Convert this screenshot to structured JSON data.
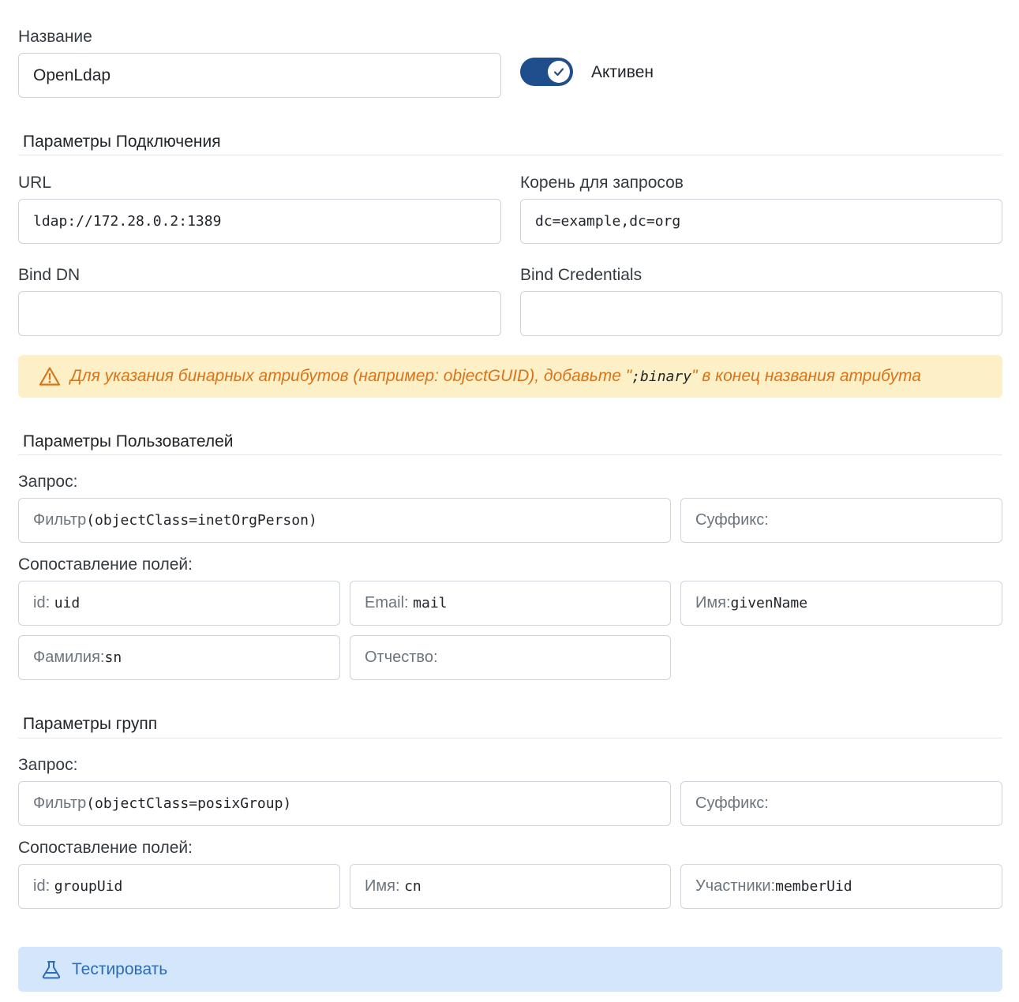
{
  "name": {
    "label": "Название",
    "value": "OpenLdap"
  },
  "active": {
    "label": "Активен",
    "checked": true
  },
  "connection": {
    "title": "Параметры Подключения",
    "url_label": "URL",
    "url_value": "ldap://172.28.0.2:1389",
    "root_label": "Корень для запросов",
    "root_value": "dc=example,dc=org",
    "bind_dn_label": "Bind DN",
    "bind_dn_value": "",
    "bind_cred_label": "Bind Credentials",
    "bind_cred_value": ""
  },
  "alert": {
    "text_before": "Для указания бинарных атрибутов (например: objectGUID), добавьте \"",
    "code": ";binary",
    "text_after": "\" в конец названия атрибута"
  },
  "users": {
    "title": "Параметры Пользователей",
    "query_label": "Запрос:",
    "filter_prefix": "Фильтр",
    "filter_value": "(objectClass=inetOrgPerson)",
    "suffix_placeholder": "Суффикс:",
    "mapping_label": "Сопоставление полей:",
    "id_prefix": "id: ",
    "id_value": "uid",
    "email_prefix": "Email: ",
    "email_value": "mail",
    "firstname_prefix": "Имя: ",
    "firstname_value": "givenName",
    "lastname_prefix": "Фамилия:",
    "lastname_value": "sn",
    "middlename_placeholder": "Отчество:"
  },
  "groups": {
    "title": "Параметры групп",
    "query_label": "Запрос:",
    "filter_prefix": "Фильтр",
    "filter_value": "(objectClass=posixGroup)",
    "suffix_placeholder": "Суффикс:",
    "mapping_label": "Сопоставление полей:",
    "id_prefix": "id: ",
    "id_value": "groupUid",
    "name_prefix": "Имя: ",
    "name_value": "cn",
    "members_prefix": "Участники:",
    "members_value": "memberUid"
  },
  "test_button": {
    "label": "Тестировать",
    "icon": "flask-icon"
  },
  "colors": {
    "primary": "#1f4e8c",
    "alert_bg": "#fdf0c6",
    "alert_text": "#d9731a",
    "button_bg": "#d3e6fb",
    "button_text": "#2b6cb8"
  }
}
